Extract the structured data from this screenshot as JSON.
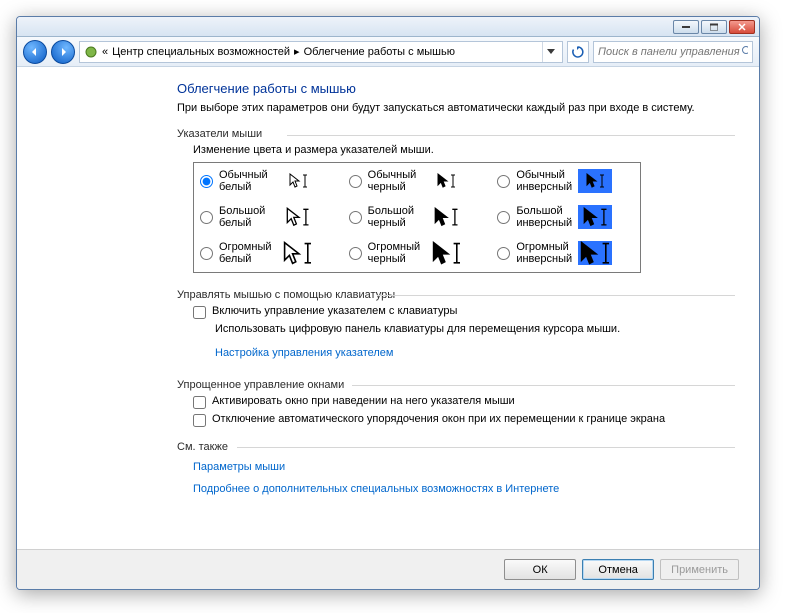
{
  "breadcrumb": {
    "prefix": "«",
    "part1": "Центр специальных возможностей",
    "part2": "Облегчение работы с мышью"
  },
  "search": {
    "placeholder": "Поиск в панели управления"
  },
  "title": "Облегчение работы с мышью",
  "subtitle": "При выборе этих параметров они будут запускаться автоматически каждый раз при входе в систему.",
  "pointers": {
    "group": "Указатели мыши",
    "desc": "Изменение цвета и размера указателей мыши.",
    "options": [
      {
        "label": "Обычный белый",
        "selected": true
      },
      {
        "label": "Обычный черный",
        "selected": false
      },
      {
        "label": "Обычный инверсный",
        "selected": false
      },
      {
        "label": "Большой белый",
        "selected": false
      },
      {
        "label": "Большой черный",
        "selected": false
      },
      {
        "label": "Большой инверсный",
        "selected": false
      },
      {
        "label": "Огромный белый",
        "selected": false
      },
      {
        "label": "Огромный черный",
        "selected": false
      },
      {
        "label": "Огромный инверсный",
        "selected": false
      }
    ]
  },
  "keyboard": {
    "group": "Управлять мышью с помощью клавиатуры",
    "check": "Включить управление указателем с клавиатуры",
    "desc": "Использовать цифровую панель клавиатуры для перемещения курсора мыши.",
    "link": "Настройка управления указателем"
  },
  "windows": {
    "group": "Упрощенное управление окнами",
    "check1": "Активировать окно при наведении на него указателя мыши",
    "check2": "Отключение автоматического упорядочения окон при их перемещении к границе экрана"
  },
  "seealso": {
    "group": "См. также",
    "link1": "Параметры мыши",
    "link2": "Подробнее о дополнительных специальных возможностях в Интернете"
  },
  "buttons": {
    "ok": "ОК",
    "cancel": "Отмена",
    "apply": "Применить"
  }
}
